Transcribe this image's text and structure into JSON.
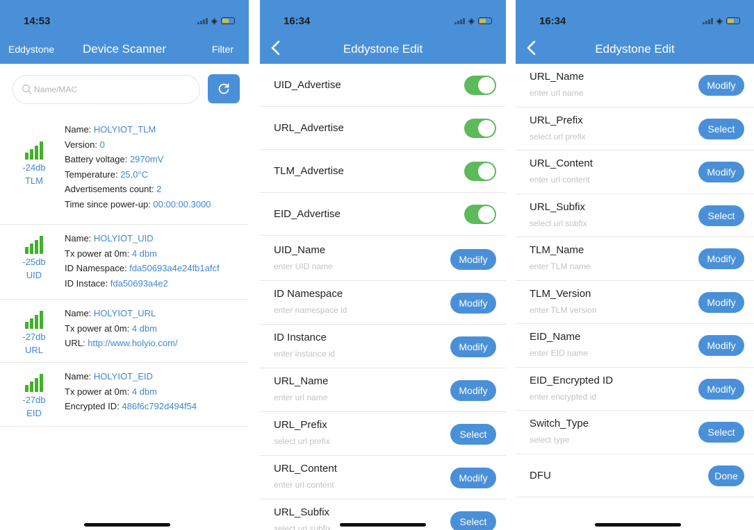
{
  "scanner": {
    "status_time": "14:53",
    "left_label": "Eddystone",
    "title": "Device Scanner",
    "right_label": "Filter",
    "search_placeholder": "Name/MAC",
    "devices": [
      {
        "db": "-24db",
        "type": "TLM",
        "signal_bars": 4,
        "lines": [
          {
            "label": "Name: ",
            "value": "HOLYIOT_TLM"
          },
          {
            "label": "Version: ",
            "value": "0"
          },
          {
            "label": "Battery voltage: ",
            "value": "2970mV"
          },
          {
            "label": "Temperature: ",
            "value": "25.0°C"
          },
          {
            "label": "Advertisements count: ",
            "value": "2"
          },
          {
            "label": "Time since power-up: ",
            "value": "00:00:00.3000"
          }
        ]
      },
      {
        "db": "-25db",
        "type": "UID",
        "signal_bars": 4,
        "lines": [
          {
            "label": "Name: ",
            "value": "HOLYIOT_UID"
          },
          {
            "label": "Tx power at 0m: ",
            "value": "4 dbm"
          },
          {
            "label": "ID Namespace: ",
            "value": "fda50693a4e24fb1afcf"
          },
          {
            "label": "ID Instace: ",
            "value": "fda50693a4e2"
          }
        ]
      },
      {
        "db": "-27db",
        "type": "URL",
        "signal_bars": 4,
        "lines": [
          {
            "label": "Name: ",
            "value": "HOLYIOT_URL"
          },
          {
            "label": "Tx power at 0m: ",
            "value": "4 dbm"
          },
          {
            "label": "URL: ",
            "value": "http://www.holyio.com/"
          }
        ]
      },
      {
        "db": "-27db",
        "type": "EID",
        "signal_bars": 4,
        "lines": [
          {
            "label": "Name: ",
            "value": "HOLYIOT_EID"
          },
          {
            "label": "Tx power at 0m: ",
            "value": "4 dbm"
          },
          {
            "label": "Encrypted ID: ",
            "value": "486f6c792d494f54"
          }
        ]
      }
    ]
  },
  "edit1": {
    "status_time": "16:34",
    "title": "Eddystone Edit",
    "toggles": [
      {
        "label": "UID_Advertise",
        "on": true
      },
      {
        "label": "URL_Advertise",
        "on": true
      },
      {
        "label": "TLM_Advertise",
        "on": true
      },
      {
        "label": "EID_Advertise",
        "on": true
      }
    ],
    "fields": [
      {
        "label": "UID_Name",
        "hint": "enter UID name",
        "action": "Modify"
      },
      {
        "label": "ID Namespace",
        "hint": "enter namespace id",
        "action": "Modify"
      },
      {
        "label": "ID Instance",
        "hint": "enter instance id",
        "action": "Modify"
      },
      {
        "label": "URL_Name",
        "hint": "enter url name",
        "action": "Modify"
      },
      {
        "label": "URL_Prefix",
        "hint": "select url prefix",
        "action": "Select"
      },
      {
        "label": "URL_Content",
        "hint": "enter url content",
        "action": "Modify"
      },
      {
        "label": "URL_Subfix",
        "hint": "select url subfix",
        "action": "Select"
      }
    ]
  },
  "edit2": {
    "status_time": "16:34",
    "title": "Eddystone Edit",
    "fields": [
      {
        "label": "URL_Name",
        "hint": "enter url name",
        "action": "Modify"
      },
      {
        "label": "URL_Prefix",
        "hint": "select url prefix",
        "action": "Select"
      },
      {
        "label": "URL_Content",
        "hint": "enter url content",
        "action": "Modify"
      },
      {
        "label": "URL_Subfix",
        "hint": "select url subfix",
        "action": "Select"
      },
      {
        "label": "TLM_Name",
        "hint": "enter TLM name",
        "action": "Modify"
      },
      {
        "label": "TLM_Version",
        "hint": "enter TLM version",
        "action": "Modify"
      },
      {
        "label": "EID_Name",
        "hint": "enter EID name",
        "action": "Modify"
      },
      {
        "label": "EID_Encrypted ID",
        "hint": "enter encrypted id",
        "action": "Modify"
      },
      {
        "label": "Switch_Type",
        "hint": "select type",
        "action": "Select"
      },
      {
        "label": "DFU",
        "hint": "",
        "action": "Done"
      }
    ]
  },
  "colors": {
    "primary": "#4a90d9",
    "toggle_on": "#5cba5a",
    "signal": "#43b02a",
    "value_text": "#3f87d4"
  }
}
